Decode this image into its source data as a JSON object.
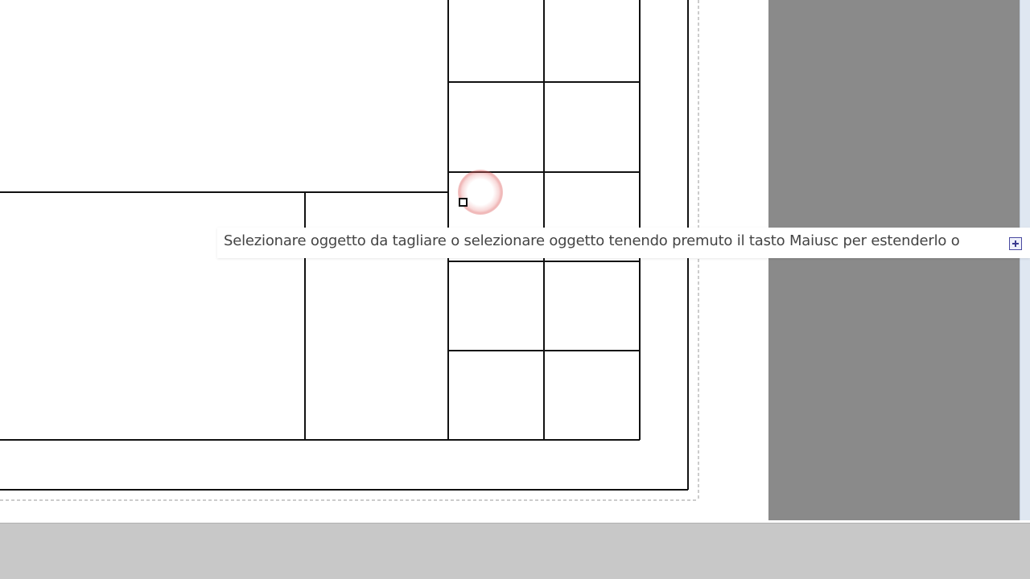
{
  "tooltip": {
    "text": "Selezionare oggetto da tagliare o selezionare oggetto tenendo premuto il tasto Maiusc per estenderlo o",
    "expand_icon": "expand-plus-icon"
  },
  "cursor": {
    "type": "pickbox"
  },
  "colors": {
    "canvas_bg": "#ffffff",
    "side_panel": "#8a8a8a",
    "status_bar": "#c8c8c8",
    "line": "#111111",
    "cursor_highlight": "#e06060"
  }
}
